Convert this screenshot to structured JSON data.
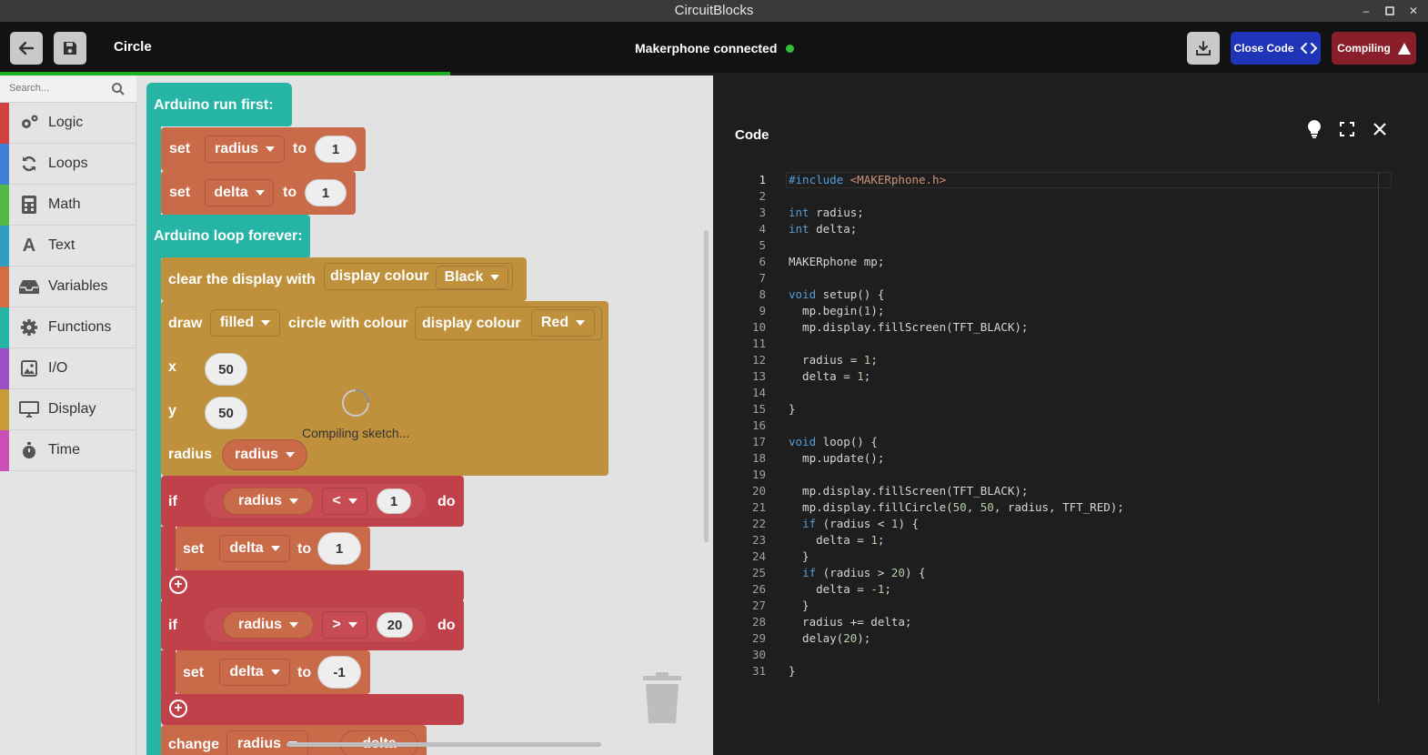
{
  "window": {
    "title": "CircuitBlocks"
  },
  "header": {
    "project_name": "Circle",
    "connection_status": "Makerphone connected",
    "close_code_label": "Close Code",
    "compiling_label": "Compiling"
  },
  "sidebar": {
    "search_placeholder": "Search...",
    "categories": [
      {
        "label": "Logic",
        "color": "#d0413e",
        "icon": "gears-icon"
      },
      {
        "label": "Loops",
        "color": "#3f7fd4",
        "icon": "refresh-icon"
      },
      {
        "label": "Math",
        "color": "#53b846",
        "icon": "calculator-icon"
      },
      {
        "label": "Text",
        "color": "#2f9ec2",
        "icon": "font-icon"
      },
      {
        "label": "Variables",
        "color": "#d46c44",
        "icon": "inbox-icon"
      },
      {
        "label": "Functions",
        "color": "#26b5a5",
        "icon": "gear-icon"
      },
      {
        "label": "I/O",
        "color": "#9a4fc7",
        "icon": "image-icon"
      },
      {
        "label": "Display",
        "color": "#c99a38",
        "icon": "monitor-icon"
      },
      {
        "label": "Time",
        "color": "#c94fb7",
        "icon": "stopwatch-icon"
      }
    ]
  },
  "workspace": {
    "run_first_label": "Arduino run first:",
    "loop_forever_label": "Arduino loop forever:",
    "set_word": "set",
    "to_word": "to",
    "if_word": "if",
    "do_word": "do",
    "x_word": "x",
    "y_word": "y",
    "radius_word": "radius",
    "var_radius": "radius",
    "var_delta": "delta",
    "val_1": "1",
    "val_50": "50",
    "val_20": "20",
    "val_neg1": "-1",
    "op_lt": "<",
    "op_gt": ">",
    "clear_display_label": "clear the display with",
    "display_colour_label": "display colour",
    "colour_black": "Black",
    "colour_red": "Red",
    "draw_label": "draw",
    "filled_option": "filled",
    "circle_with_colour_label": "circle with colour",
    "change_label": "change",
    "compiling_sketch": "Compiling sketch..."
  },
  "code_panel": {
    "title": "Code",
    "lines": [
      "#include <MAKERphone.h>",
      "",
      "int radius;",
      "int delta;",
      "",
      "MAKERphone mp;",
      "",
      "void setup() {",
      "  mp.begin(1);",
      "  mp.display.fillScreen(TFT_BLACK);",
      "",
      "  radius = 1;",
      "  delta = 1;",
      "",
      "}",
      "",
      "void loop() {",
      "  mp.update();",
      "",
      "  mp.display.fillScreen(TFT_BLACK);",
      "  mp.display.fillCircle(50, 50, radius, TFT_RED);",
      "  if (radius < 1) {",
      "    delta = 1;",
      "  }",
      "  if (radius > 20) {",
      "    delta = -1;",
      "  }",
      "  radius += delta;",
      "  delay(20);",
      "",
      "}"
    ]
  }
}
